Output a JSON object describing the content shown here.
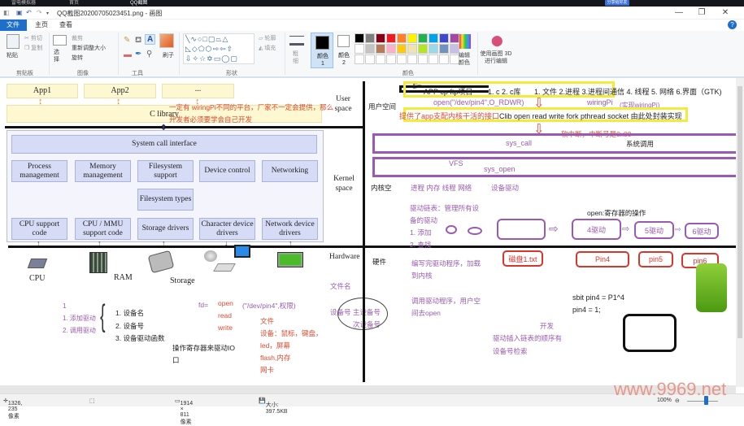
{
  "browser": {
    "tabs": [
      "雷电模拟器",
      "首页",
      "QQ截图"
    ],
    "share_button": "分享给好友"
  },
  "window": {
    "title": "QQ截图20200705023451.png - 画图",
    "controls": {
      "minimize": "—",
      "maximize": "❐",
      "close": "✕"
    }
  },
  "ribbon": {
    "tabs": [
      "文件",
      "主页",
      "查看"
    ],
    "active_tab": "主页",
    "clipboard": {
      "paste": "粘贴",
      "cut": "剪切",
      "copy": "复制",
      "label": "剪贴板"
    },
    "image": {
      "select": "选择",
      "crop": "裁剪",
      "resize": "重新调整大小",
      "rotate": "旋转",
      "label": "图像"
    },
    "tools": {
      "label": "工具"
    },
    "brushes": {
      "label": "刷子"
    },
    "shapes": {
      "outline": "轮廓",
      "fill": "填充",
      "label": "形状"
    },
    "size": {
      "label": "粗细"
    },
    "color1": "颜色 1",
    "color2": "颜色 2",
    "colors_label": "颜色",
    "edit_colors": "编辑颜色",
    "paint3d": "使用画图 3D 进行编辑",
    "palette_row1": [
      "#000000",
      "#7f7f7f",
      "#880015",
      "#ed1c24",
      "#ff7f27",
      "#fff200",
      "#22b14c",
      "#00a2e8",
      "#3f48cc",
      "#a349a4"
    ],
    "palette_row2": [
      "#ffffff",
      "#c3c3c3",
      "#b97a57",
      "#ffaec9",
      "#ffc90e",
      "#efe4b0",
      "#b5e61d",
      "#99d9ea",
      "#7092be",
      "#c8bfe7"
    ]
  },
  "diagram_left": {
    "apps": [
      "App1",
      "App2",
      "..."
    ],
    "c_library": "C library",
    "user_space": "User space",
    "kernel_space": "Kernel space",
    "hardware": "Hardware",
    "annotation_red_1": "一定有    wiringPi不同的平台，厂家不一定会提供，那么",
    "annotation_red_2": "开发者必须要学会自己开发",
    "syscall": "System call interface",
    "row1": [
      "Process management",
      "Memory management",
      "Filesystem support",
      "Device control",
      "Networking"
    ],
    "fs_types": "Filesystem types",
    "row3": [
      "CPU support code",
      "CPU / MMU support code",
      "Storage drivers",
      "Character device drivers",
      "Network device drivers"
    ],
    "hw": [
      "CPU",
      "RAM",
      "Storage"
    ]
  },
  "notes_bottom": {
    "one": "1",
    "steps": [
      "1. 添加驱动",
      "2. 调用驱动"
    ],
    "items": [
      "1. 设备名",
      "2. 设备号",
      "3. 设备驱动函数"
    ],
    "fd": "fd=",
    "calls": [
      "open",
      "read",
      "write"
    ],
    "open_args": "(\"/dev/pin4\",权限)",
    "reg_note": "操作寄存器来驱动IO口",
    "files": [
      "文件",
      "设备：鼠标，键盘，",
      "led，屏幕",
      "flash,内存",
      "网卡"
    ],
    "filename": "文件名",
    "devno": "设备号  主设备号",
    "minor": "次设备号"
  },
  "diagram_right": {
    "user_space_label": "用户空间",
    "app_line": "APP  cp ftp项目",
    "c_items": "1. c  2. c库",
    "topics": "1. 文件 2.进程 3.进程间通信 4. 线程 5. 网络  6.界面（GTK)",
    "open_call": "open(\"/dev/pin4\",O_RDWR)",
    "wiringpi": "wiringPi",
    "wiringpi_impl": "(实现wiringPi)",
    "clib_red": "提供了app支配内核干活的接口",
    "clib_black": "Clib  open read write fork pthread socket 由此处封装实现",
    "soft_int": "软中断，中断号是0x80",
    "sys_call": "sys_call",
    "syscall_cn": "系统调用",
    "vfs": "VFS",
    "sys_open": "sys_open",
    "kernel_label": "内核空",
    "kernel_items": "进程 内存 线程 网络",
    "device_driver": "设备驱动",
    "driver_list": [
      "驱动链表：管理所有设",
      "备的驱动",
      "1. 添加",
      "2. 查找"
    ],
    "open_reg": "open:寄存器的操作",
    "drivers": [
      "",
      "4驱动",
      "5驱动",
      "6驱动"
    ],
    "hw_label": "硬件",
    "hw_note": [
      "编写完驱动程序，加载",
      "到内核"
    ],
    "call_note": [
      "调用驱动程序，用户空",
      "间去open"
    ],
    "hw_boxes": [
      "磁盘1.txt",
      "Pin4",
      "pin5",
      "pin6"
    ],
    "kaifa": "开发",
    "insert_note": [
      "驱动插入链表的顺序有",
      "设备号检索"
    ],
    "code": [
      "sbit pin4 = P1^4",
      "pin4 = 1;"
    ]
  },
  "status": {
    "cursor": "1326, 235像素",
    "dimensions": "1914 × 811像素",
    "size": "大小: 397.5KB",
    "zoom": "100%"
  },
  "watermark": "www.9969.net"
}
